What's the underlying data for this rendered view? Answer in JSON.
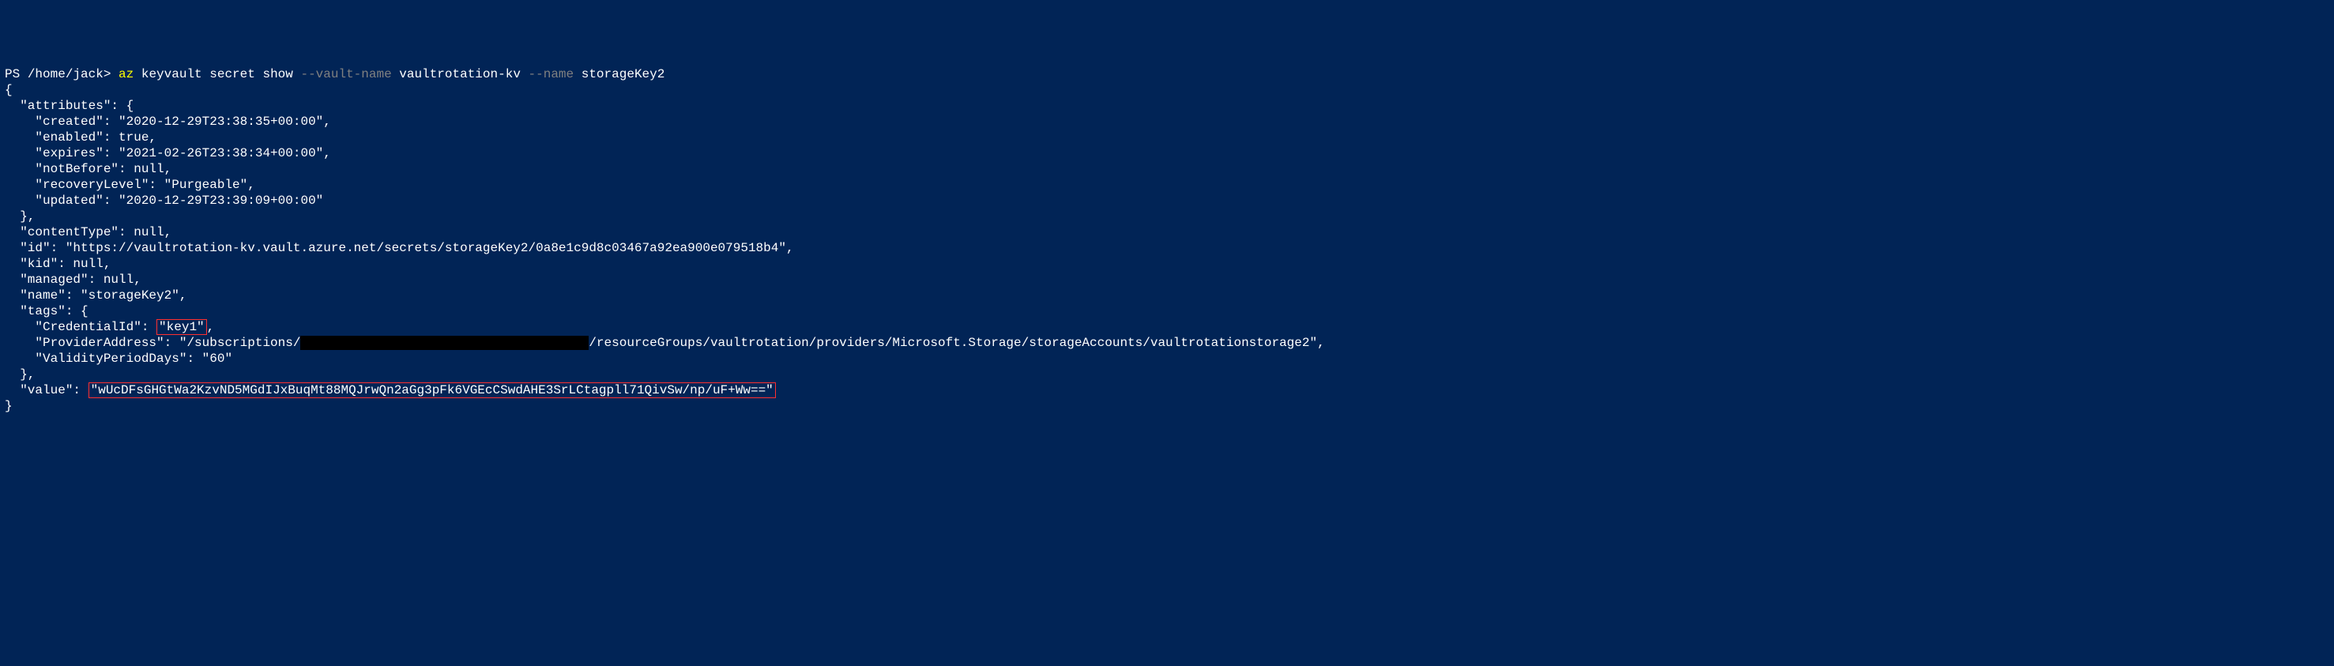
{
  "prompt": {
    "ps": "PS ",
    "path": "/home/jack",
    "caret": "> "
  },
  "command": {
    "exe": "az",
    "sub": " keyvault secret show ",
    "flag_vault": "--vault-name",
    "val_vault": " vaultrotation-kv ",
    "flag_name": "--name",
    "val_name": " storageKey2"
  },
  "lines": {
    "l01": "{",
    "l02": "  \"attributes\": {",
    "l03": "    \"created\": \"2020-12-29T23:38:35+00:00\",",
    "l04": "    \"enabled\": true,",
    "l05": "    \"expires\": \"2021-02-26T23:38:34+00:00\",",
    "l06": "    \"notBefore\": null,",
    "l07": "    \"recoveryLevel\": \"Purgeable\",",
    "l08": "    \"updated\": \"2020-12-29T23:39:09+00:00\"",
    "l09": "  },",
    "l10": "  \"contentType\": null,",
    "l11": "  \"id\": \"https://vaultrotation-kv.vault.azure.net/secrets/storageKey2/0a8e1c9d8c03467a92ea900e079518b4\",",
    "l12": "  \"kid\": null,",
    "l13": "  \"managed\": null,",
    "l14": "  \"name\": \"storageKey2\",",
    "l15": "  \"tags\": {",
    "l16a": "    \"CredentialId\": ",
    "l16b": "\"key1\"",
    "l16c": ",",
    "l17a": "    \"ProviderAddress\": \"/subscriptions/",
    "l17redacted": "                                      ",
    "l17b": "/resourceGroups/vaultrotation/providers/Microsoft.Storage/storageAccounts/vaultrotationstorage2\",",
    "l18": "    \"ValidityPeriodDays\": \"60\"",
    "l19": "  },",
    "l20a": "  \"value\": ",
    "l20b": "\"wUcDFsGHGtWa2KzvND5MGdIJxBuqMt88MQJrwQn2aGg3pFk6VGEcCSwdAHE3SrLCtagpll71QivSw/np/uF+Ww==\"",
    "l21": "}"
  }
}
